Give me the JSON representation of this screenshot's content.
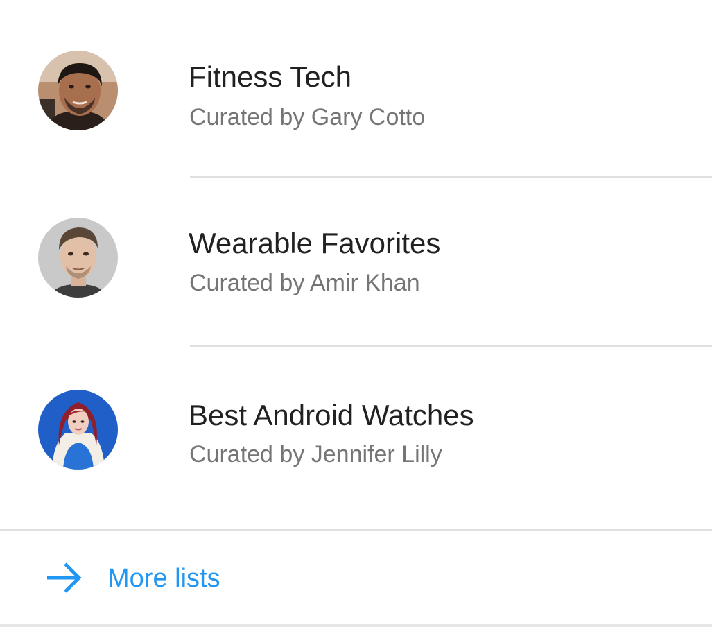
{
  "lists": [
    {
      "title": "Fitness Tech",
      "curator": "Curated by Gary Cotto",
      "avatar": "avatar-photo-man-dark-hair"
    },
    {
      "title": "Wearable Favorites",
      "curator": "Curated by Amir Khan",
      "avatar": "avatar-photo-man-short-hair"
    },
    {
      "title": "Best Android Watches",
      "curator": "Curated by Jennifer Lilly",
      "avatar": "avatar-photo-woman-red-hair"
    }
  ],
  "footer": {
    "icon": "arrow-right-icon",
    "label": "More lists"
  },
  "colors": {
    "accent": "#2196f3",
    "title_text": "#212121",
    "subtitle_text": "#757575",
    "divider": "#e0e0e0"
  }
}
